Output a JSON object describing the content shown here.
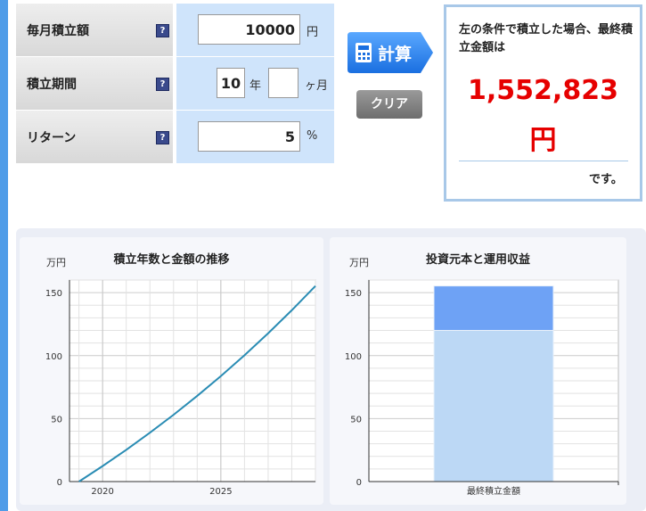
{
  "form": {
    "rows": [
      {
        "label": "毎月積立額",
        "value": "10000",
        "unit": "円"
      },
      {
        "label": "積立期間",
        "years": "10",
        "years_unit": "年",
        "months": "",
        "months_unit": "ヶ月"
      },
      {
        "label": "リターン",
        "value": "5",
        "unit": "%"
      }
    ],
    "help_glyph": "?"
  },
  "buttons": {
    "calculate": "計算",
    "clear": "クリア"
  },
  "result": {
    "description": "左の条件で積立した場合、最終積立金額は",
    "amount": "1,552,823",
    "currency": "円",
    "suffix": "です。",
    "amount_color": "#e60000"
  },
  "chart_data": [
    {
      "type": "line",
      "title": "積立年数と金額の推移",
      "unit_label": "万円",
      "x": [
        2019,
        2020,
        2021,
        2022,
        2023,
        2024,
        2025,
        2026,
        2027,
        2028,
        2029
      ],
      "series": [
        {
          "values": [
            0,
            12.3,
            25.2,
            38.8,
            53.0,
            68.0,
            83.7,
            100.3,
            117.7,
            136.0,
            155.3
          ],
          "color": "#2a8cb4"
        }
      ],
      "xticks": [
        2020,
        2025
      ],
      "yticks": [
        0,
        50,
        100,
        150
      ],
      "xlim": [
        2018.6,
        2029.0
      ],
      "ylim": [
        0,
        160
      ],
      "grid": true
    },
    {
      "type": "bar",
      "title": "投資元本と運用収益",
      "unit_label": "万円",
      "categories": [
        "最終積立金額"
      ],
      "series": [
        {
          "values": [
            120
          ],
          "color": "#bcd8f5"
        },
        {
          "values": [
            35.3
          ],
          "color": "#6ea2f5"
        }
      ],
      "stacked": true,
      "yticks": [
        0,
        50,
        100,
        150
      ],
      "ylim": [
        0,
        160
      ],
      "grid": true
    }
  ]
}
